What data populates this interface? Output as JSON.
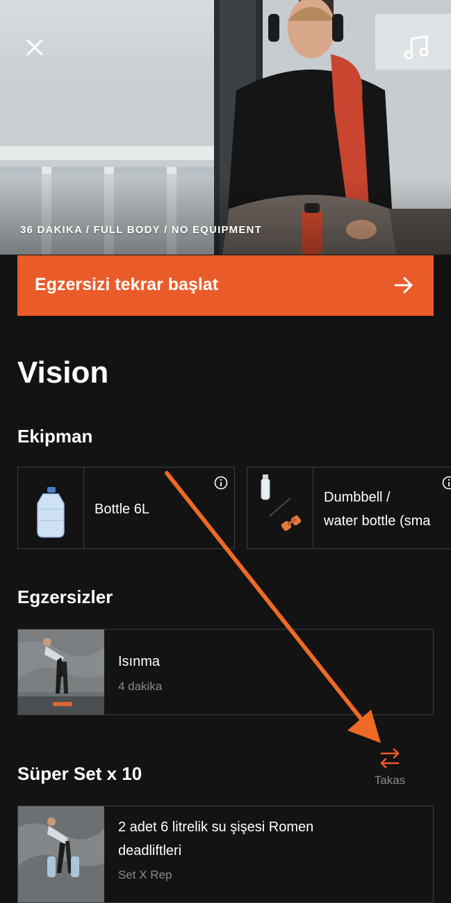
{
  "hero": {
    "meta": "36 DAKIKA / FULL BODY / NO EQUIPMENT"
  },
  "actions": {
    "restart_label": "Egzersizi tekrar başlat"
  },
  "workout": {
    "title": "Vision"
  },
  "equipment": {
    "heading": "Ekipman",
    "items": [
      {
        "label": "Bottle 6L"
      },
      {
        "label": "Dumbbell /\nwater bottle (sma"
      }
    ]
  },
  "exercises": {
    "heading": "Egzersizler",
    "items": [
      {
        "name": "Isınma",
        "detail": "4 dakika"
      }
    ]
  },
  "superset": {
    "heading": "Süper Set x 10",
    "swap_label": "Takas",
    "items": [
      {
        "name_line1": "2 adet 6 litrelik su şişesi Romen",
        "name_line2": "deadliftleri",
        "detail": "Set X Rep"
      }
    ]
  },
  "colors": {
    "accent": "#ea5b2a",
    "background": "#131313",
    "border": "#3e3e3e",
    "muted_text": "#8a8a8a"
  },
  "icons": [
    "close-icon",
    "music-note-icon",
    "arrow-right-icon",
    "info-icon",
    "swap-icon"
  ]
}
